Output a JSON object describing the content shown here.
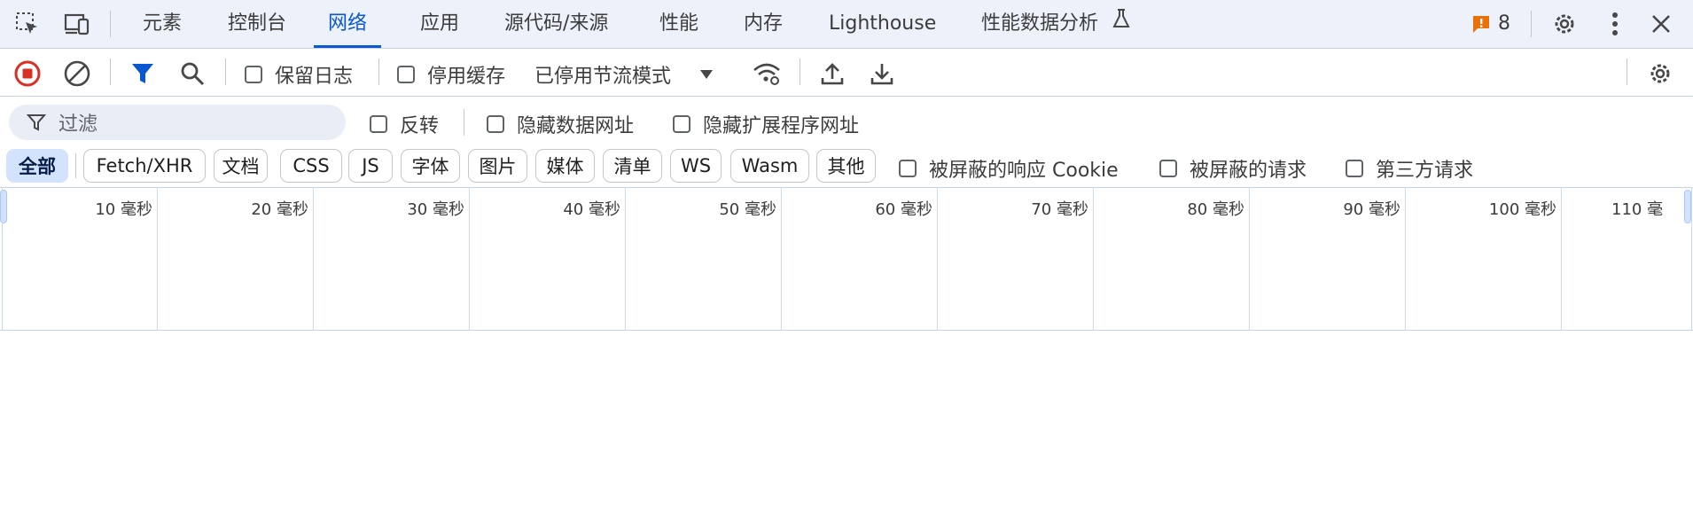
{
  "tabs": [
    "元素",
    "控制台",
    "网络",
    "应用",
    "源代码/来源",
    "性能",
    "内存",
    "Lighthouse",
    "性能数据分析"
  ],
  "active_tab": "网络",
  "issues_count": "8",
  "toolbar": {
    "preserve_log": "保留日志",
    "disable_cache": "停用缓存",
    "throttle": "已停用节流模式"
  },
  "filter": {
    "placeholder": "过滤",
    "invert": "反转",
    "hide_data_urls": "隐藏数据网址",
    "hide_ext_urls": "隐藏扩展程序网址"
  },
  "types": [
    "全部",
    "Fetch/XHR",
    "文档",
    "CSS",
    "JS",
    "字体",
    "图片",
    "媒体",
    "清单",
    "WS",
    "Wasm",
    "其他"
  ],
  "type_checks": [
    "被屏蔽的响应 Cookie",
    "被屏蔽的请求",
    "第三方请求"
  ],
  "timeline_ticks": [
    "10 毫秒",
    "20 毫秒",
    "30 毫秒",
    "40 毫秒",
    "50 毫秒",
    "60 毫秒",
    "70 毫秒",
    "80 毫秒",
    "90 毫秒",
    "100 毫秒",
    "110 毫"
  ],
  "colors": {
    "accent": "#0b57d0",
    "record": "#d93025",
    "issue": "#e8710a"
  }
}
